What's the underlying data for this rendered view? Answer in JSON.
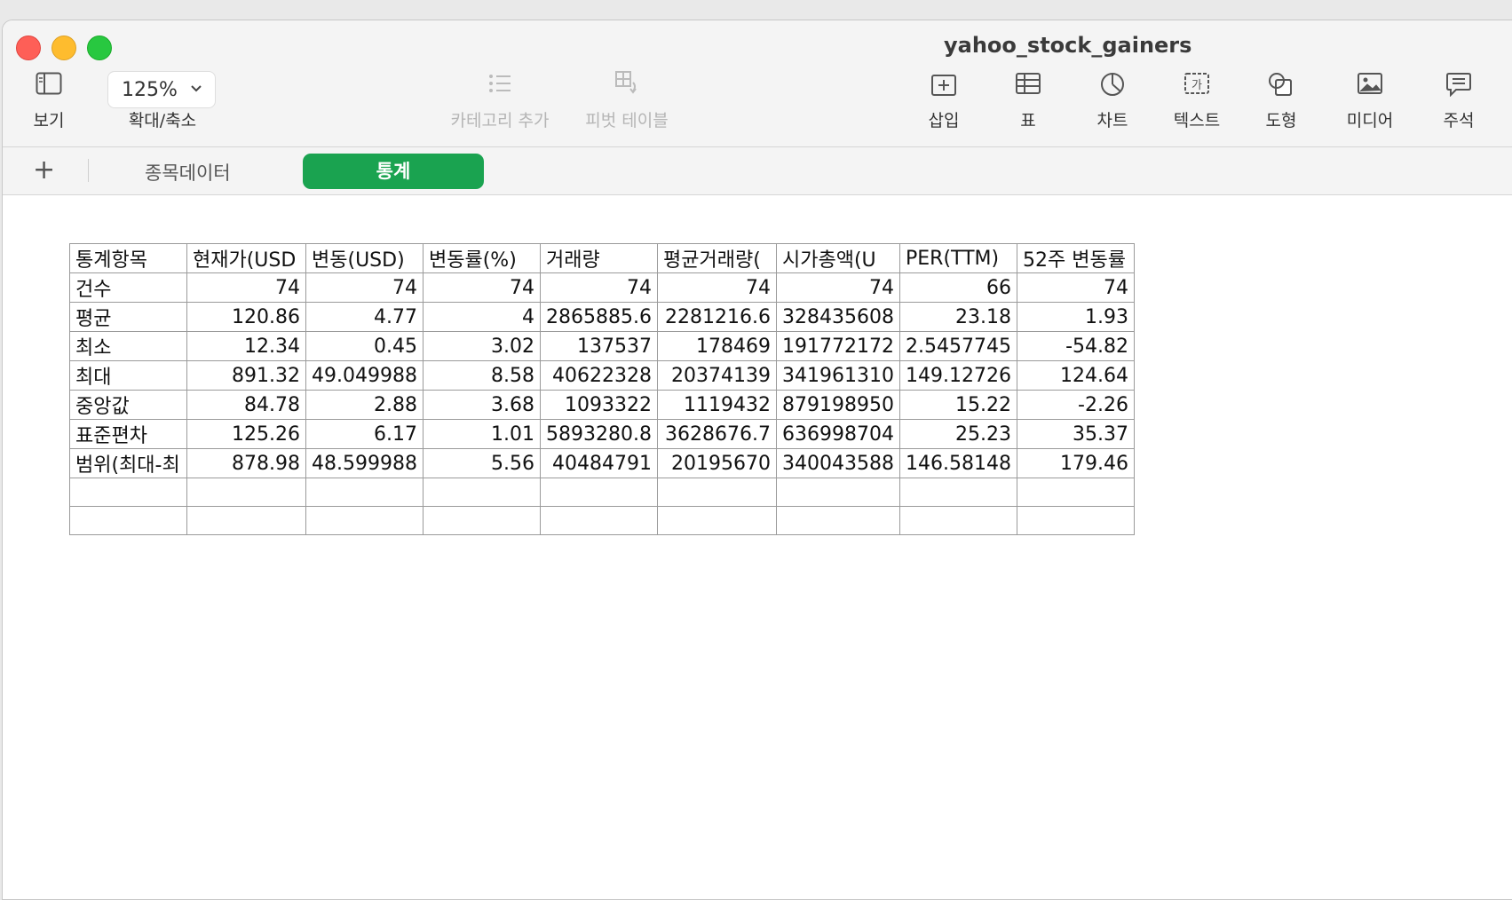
{
  "window": {
    "title": "yahoo_stock_gainers"
  },
  "toolbar": {
    "view_label": "보기",
    "zoom_value": "125%",
    "zoom_label": "확대/축소",
    "category_label": "카테고리 추가",
    "pivot_label": "피벗 테이블",
    "insert_label": "삽입",
    "table_label": "표",
    "chart_label": "차트",
    "text_label": "텍스트",
    "shape_label": "도형",
    "media_label": "미디어",
    "comment_label": "주석"
  },
  "sheets": {
    "add": "+",
    "tabs": [
      "종목데이터",
      "통계"
    ],
    "active": "통계"
  },
  "table": {
    "headers": [
      "통계항목",
      "현재가(USD",
      "변동(USD)",
      "변동률(%)",
      "거래량",
      "평균거래량(",
      "시가총액(U",
      "PER(TTM)",
      "52주 변동률"
    ],
    "rows": [
      [
        "건수",
        "74",
        "74",
        "74",
        "74",
        "74",
        "74",
        "66",
        "74"
      ],
      [
        "평균",
        "120.86",
        "4.77",
        "4",
        "2865885.6",
        "2281216.6",
        "328435608",
        "23.18",
        "1.93"
      ],
      [
        "최소",
        "12.34",
        "0.45",
        "3.02",
        "137537",
        "178469",
        "191772172",
        "2.5457745",
        "-54.82"
      ],
      [
        "최대",
        "891.32",
        "49.049988",
        "8.58",
        "40622328",
        "20374139",
        "341961310",
        "149.12726",
        "124.64"
      ],
      [
        "중앙값",
        "84.78",
        "2.88",
        "3.68",
        "1093322",
        "1119432",
        "879198950",
        "15.22",
        "-2.26"
      ],
      [
        "표준편차",
        "125.26",
        "6.17",
        "1.01",
        "5893280.8",
        "3628676.7",
        "636998704",
        "25.23",
        "35.37"
      ],
      [
        "범위(최대-최",
        "878.98",
        "48.599988",
        "5.56",
        "40484791",
        "20195670",
        "340043588",
        "146.58148",
        "179.46"
      ],
      [
        "",
        "",
        "",
        "",
        "",
        "",
        "",
        "",
        ""
      ],
      [
        "",
        "",
        "",
        "",
        "",
        "",
        "",
        "",
        ""
      ]
    ]
  }
}
